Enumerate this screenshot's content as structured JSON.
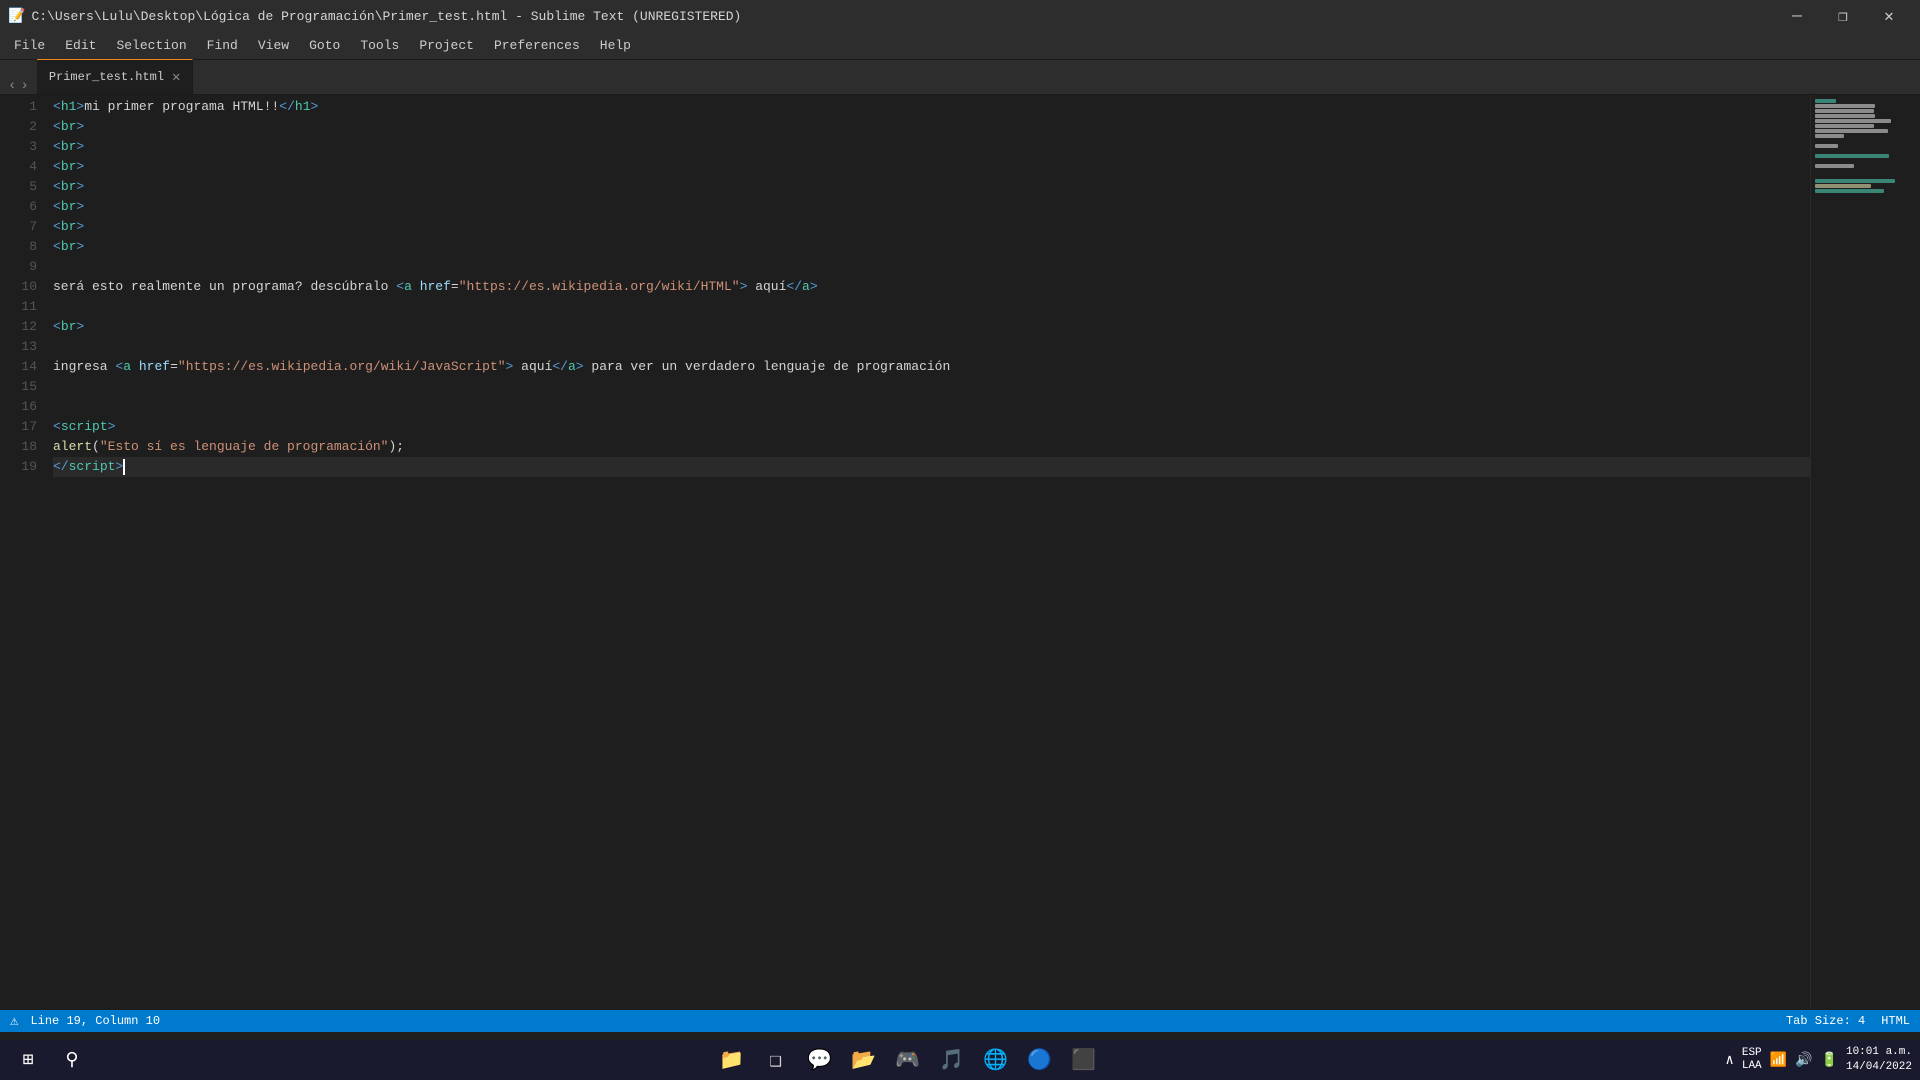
{
  "titlebar": {
    "title": "C:\\Users\\Lulu\\Desktop\\Lógica de Programación\\Primer_test.html - Sublime Text (UNREGISTERED)",
    "minimize": "—",
    "restore": "❐",
    "close": "✕"
  },
  "menubar": {
    "items": [
      "File",
      "Edit",
      "Selection",
      "Find",
      "View",
      "Goto",
      "Tools",
      "Project",
      "Preferences",
      "Help"
    ]
  },
  "tabs": [
    {
      "label": "Primer_test.html",
      "active": true
    }
  ],
  "nav": {
    "back": "‹",
    "forward": "›"
  },
  "code_lines": [
    {
      "num": 1,
      "content_html": "<span class='tag'>&lt;</span><span class='tag-name'>h1</span><span class='tag'>&gt;</span><span class='text-content'>mi primer programa HTML!!</span><span class='tag'>&lt;/</span><span class='tag-name'>h1</span><span class='tag'>&gt;</span>"
    },
    {
      "num": 2,
      "content_html": "<span class='tag'>&lt;</span><span class='tag-name'>br</span><span class='tag'>&gt;</span>"
    },
    {
      "num": 3,
      "content_html": "<span class='tag'>&lt;</span><span class='tag-name'>br</span><span class='tag'>&gt;</span>"
    },
    {
      "num": 4,
      "content_html": "<span class='tag'>&lt;</span><span class='tag-name'>br</span><span class='tag'>&gt;</span>"
    },
    {
      "num": 5,
      "content_html": "<span class='tag'>&lt;</span><span class='tag-name'>br</span><span class='tag'>&gt;</span>"
    },
    {
      "num": 6,
      "content_html": "<span class='tag'>&lt;</span><span class='tag-name'>br</span><span class='tag'>&gt;</span>"
    },
    {
      "num": 7,
      "content_html": "<span class='tag'>&lt;</span><span class='tag-name'>br</span><span class='tag'>&gt;</span>"
    },
    {
      "num": 8,
      "content_html": "<span class='tag'>&lt;</span><span class='tag-name'>br</span><span class='tag'>&gt;</span>"
    },
    {
      "num": 9,
      "content_html": ""
    },
    {
      "num": 10,
      "content_html": "<span class='plain'>será esto realmente un programa? descúbralo </span><span class='tag'>&lt;</span><span class='tag-name'>a</span> <span class='attr-name'>href</span><span class='plain'>=</span><span class='attr-value'>\"https://es.wikipedia.org/wiki/HTML\"</span><span class='tag'>&gt;</span><span class='plain'> aquí</span><span class='tag'>&lt;/</span><span class='tag-name'>a</span><span class='tag'>&gt;</span>"
    },
    {
      "num": 11,
      "content_html": ""
    },
    {
      "num": 12,
      "content_html": "<span class='tag'>&lt;</span><span class='tag-name'>br</span><span class='tag'>&gt;</span>"
    },
    {
      "num": 13,
      "content_html": ""
    },
    {
      "num": 14,
      "content_html": "<span class='plain'>ingresa </span><span class='tag'>&lt;</span><span class='tag-name'>a</span> <span class='attr-name'>href</span><span class='plain'>=</span><span class='attr-value'>\"https://es.wikipedia.org/wiki/JavaScript\"</span><span class='tag'>&gt;</span><span class='plain'> aquí</span><span class='tag'>&lt;/</span><span class='tag-name'>a</span><span class='tag'>&gt;</span><span class='plain'> para ver un verdadero lenguaje de programación</span>"
    },
    {
      "num": 15,
      "content_html": ""
    },
    {
      "num": 16,
      "content_html": ""
    },
    {
      "num": 17,
      "content_html": "<span class='tag'>&lt;</span><span class='tag-name'>script</span><span class='tag'>&gt;</span>"
    },
    {
      "num": 18,
      "content_html": "<span class='function-name'>alert</span><span class='bracket'>(</span><span class='string'>\"Esto sí es lenguaje de programación\"</span><span class='bracket'>)</span><span class='plain'>;</span>"
    },
    {
      "num": 19,
      "content_html": "<span class='tag'>&lt;/</span><span class='tag-name'>script</span><span class='tag'>&gt;</span>"
    }
  ],
  "statusbar": {
    "line_col": "Line 19, Column 10",
    "tab_size": "Tab Size: 4",
    "language": "HTML"
  },
  "taskbar": {
    "start_icon": "⊞",
    "search_icon": "⚲",
    "apps": [
      {
        "name": "file-explorer",
        "icon": "📁"
      },
      {
        "name": "task-view",
        "icon": "❑"
      },
      {
        "name": "teams",
        "icon": "💬"
      },
      {
        "name": "explorer2",
        "icon": "📂"
      },
      {
        "name": "app3",
        "icon": "🎮"
      },
      {
        "name": "spotify",
        "icon": "🎵"
      },
      {
        "name": "edge",
        "icon": "🌐"
      },
      {
        "name": "chrome",
        "icon": "🔵"
      },
      {
        "name": "sublime",
        "icon": "⬛"
      }
    ],
    "tray": {
      "chevron": "∧",
      "lang": "ESP\nLAA",
      "network": "📶",
      "sound": "🔊",
      "battery": "🔋",
      "time": "10:01 a.m.",
      "date": "14/04/2022"
    }
  }
}
